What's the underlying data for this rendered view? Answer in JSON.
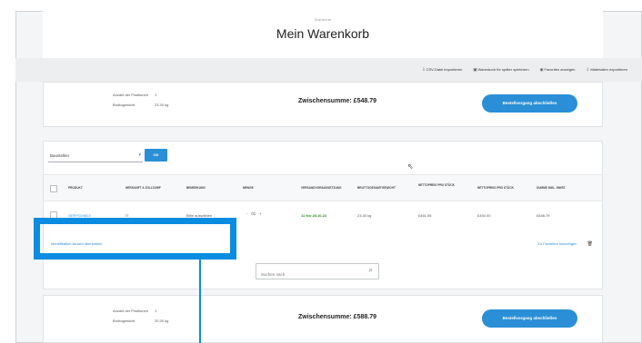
{
  "header": {
    "breadcrumb": "Startseite",
    "title": "Mein Warenkorb"
  },
  "toolbar": {
    "links": [
      {
        "icon": "import-icon",
        "label": "CSV-Datei importieren"
      },
      {
        "icon": "save-icon",
        "label": "Warenkorb für später speichern"
      },
      {
        "icon": "view-icon",
        "label": "Favoriten anzeigen"
      },
      {
        "icon": "import-icon",
        "label": "Materialien exportieren"
      }
    ]
  },
  "summary_top": {
    "count_label": "Anzahl der Positionen",
    "count_value": "1",
    "weight_label": "Bruttogewicht",
    "weight_value": "23.30 kg",
    "subtotal": "Zwischensumme: £548.79",
    "checkout_button": "Bestellvorgang abschließen"
  },
  "filter": {
    "selected": "Baustellen",
    "ok_label": "OK"
  },
  "table": {
    "columns": [
      "Produkt",
      "Herkunft & Zolltarif",
      "Bemerkung",
      "Menge",
      "Versandvoraussetzung",
      "Bruttogesamtgewicht",
      "Nettopreis pro Stück",
      "Nettopreis pro Stück",
      "Summe inkl. MwSt."
    ],
    "rows": [
      {
        "product": "GERY024613",
        "origin": "IT",
        "remark": "Bitte auswählen",
        "qty": "01",
        "minus": "-",
        "plus": "+",
        "shipping": "11 Kw 28.10.23",
        "weight": "23.30 kg",
        "price_each": "£461.55",
        "price_each2": "£450.00",
        "total": "£548.79"
      }
    ],
    "row_links": "Identifikation  Anzahl  übersetzen",
    "row_action": "Zu Favoriten hinzufügen"
  },
  "search": {
    "placeholder": "Suchen nach"
  },
  "summary_bottom": {
    "count_label": "Anzahl der Positionen",
    "count_value": "1",
    "weight_label": "Bruttogewicht",
    "weight_value": "20.30 kg",
    "subtotal": "Zwischensumme: £588.79",
    "checkout_button": "Bestellvorgang abschließen"
  },
  "colors": {
    "accent": "#2a8fd6",
    "highlight": "#0a8de0",
    "success": "#2a8a2a"
  }
}
